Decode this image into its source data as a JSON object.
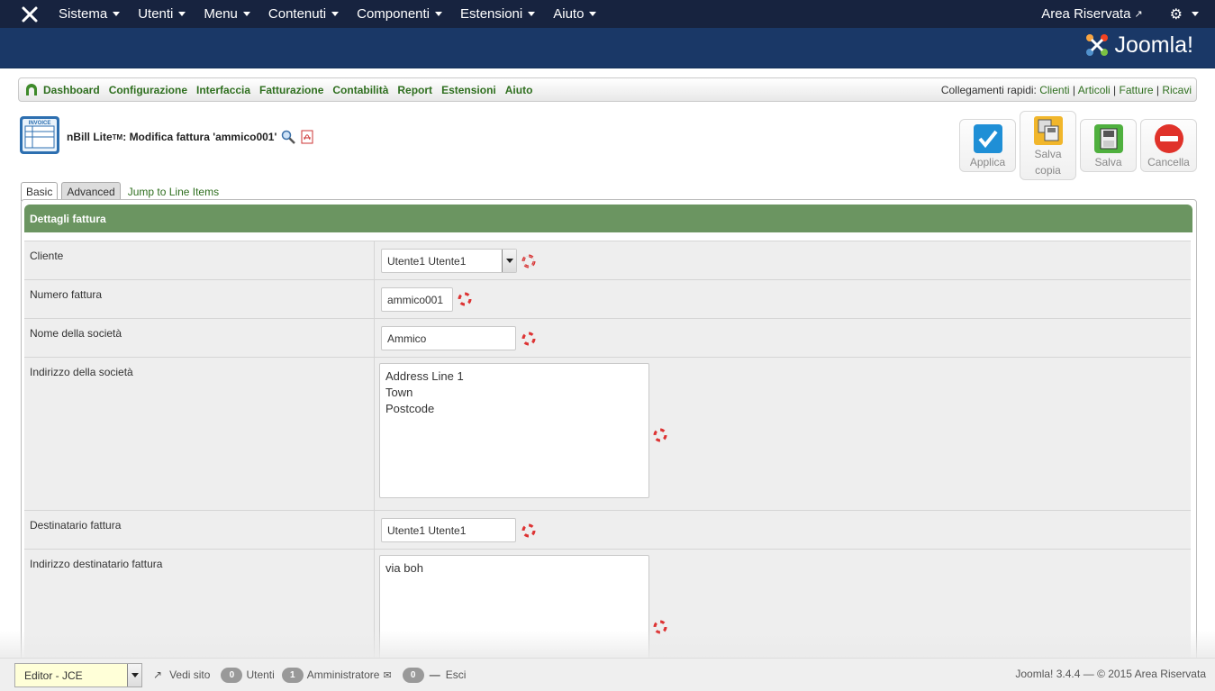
{
  "topnav": {
    "menu": [
      "Sistema",
      "Utenti",
      "Menu",
      "Contenuti",
      "Componenti",
      "Estensioni",
      "Aiuto"
    ],
    "area_riservata": "Area Riservata"
  },
  "header": {
    "brand": "Joomla!"
  },
  "nbill_menu": {
    "items": [
      "Dashboard",
      "Configurazione",
      "Interfaccia",
      "Fatturazione",
      "Contabilità",
      "Report",
      "Estensioni",
      "Aiuto"
    ],
    "quick_label": "Collegamenti rapidi:",
    "quick_links": [
      "Clienti",
      "Articoli",
      "Fatture",
      "Ricavi"
    ]
  },
  "page": {
    "app": "nBill Lite",
    "tm": "TM",
    "title": ": Modifica fattura 'ammico001'"
  },
  "toolbar": {
    "apply": "Applica",
    "save_copy_1": "Salva",
    "save_copy_2": "copia",
    "save": "Salva",
    "cancel": "Cancella"
  },
  "tabs": {
    "basic": "Basic",
    "advanced": "Advanced",
    "jump": "Jump to Line Items"
  },
  "form": {
    "section": "Dettagli fattura",
    "cliente_label": "Cliente",
    "cliente_value": "Utente1 Utente1",
    "numero_label": "Numero fattura",
    "numero_value": "ammico001",
    "societa_label": "Nome della società",
    "societa_value": "Ammico",
    "indirizzo_label": "Indirizzo della società",
    "indirizzo_value": "Address Line 1\nTown\nPostcode",
    "destinatario_label": "Destinatario fattura",
    "destinatario_value": "Utente1 Utente1",
    "ind_dest_label": "Indirizzo destinatario fattura",
    "ind_dest_value": "via boh"
  },
  "status": {
    "editor": "Editor - JCE",
    "view_site": "Vedi sito",
    "users_count": "0",
    "users_label": "Utenti",
    "admin_count": "1",
    "admin_label": "Amministratore",
    "msg_count": "0",
    "logout": "Esci",
    "copyright": "Joomla! 3.4.4  —  © 2015 Area Riservata"
  }
}
